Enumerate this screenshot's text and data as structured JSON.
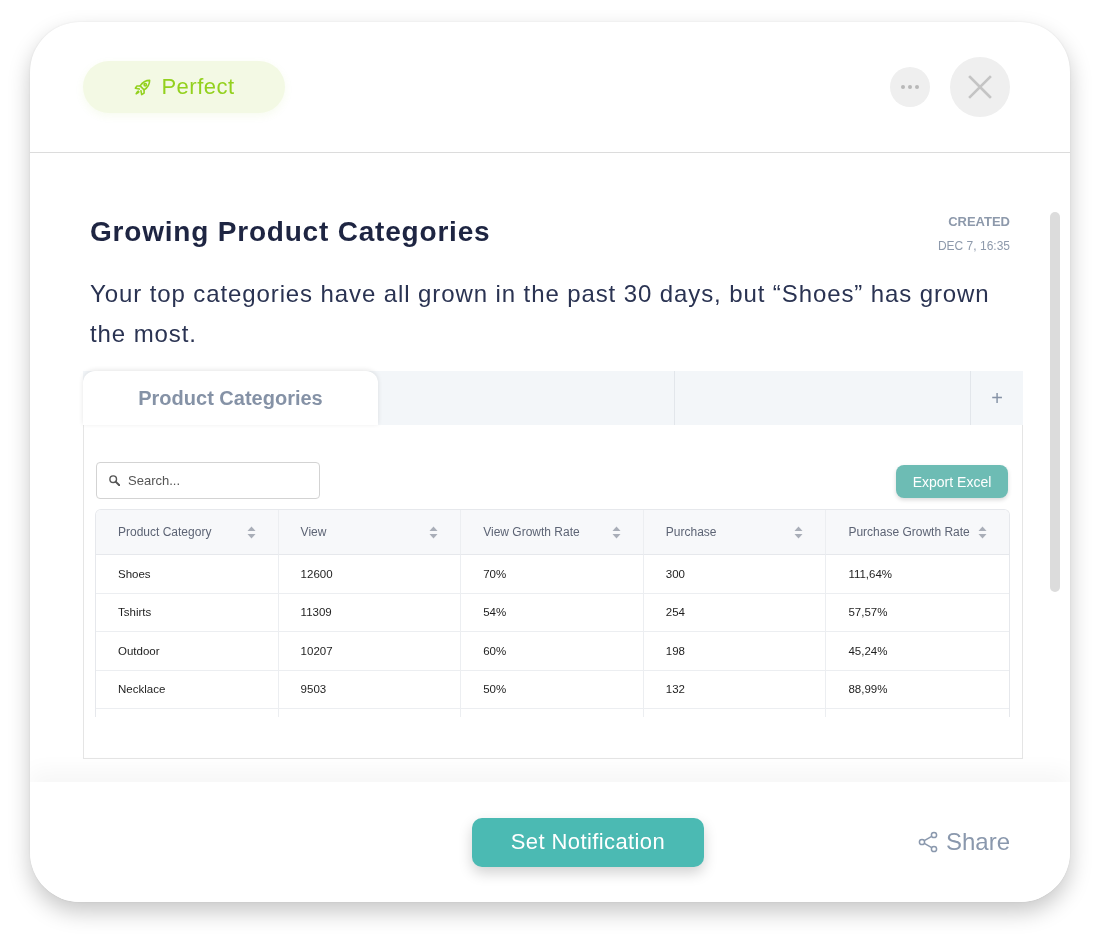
{
  "header": {
    "badge": {
      "label": "Perfect"
    }
  },
  "insight": {
    "title": "Growing Product Categories",
    "created_label": "CREATED",
    "created_date": "DEC 7, 16:35",
    "description": "Your top categories have all grown in the past 30 days, but “Shoes” has grown the most."
  },
  "embedded_view": {
    "tabs": [
      {
        "label": "Product Categories",
        "selected": true
      },
      {
        "selected": false
      },
      {
        "selected": false
      }
    ],
    "add_tab": "+",
    "search": {
      "placeholder": "Search..."
    },
    "export_button": "Export Excel",
    "table": {
      "columns": [
        "Product Category",
        "View",
        "View Growth Rate",
        "Purchase",
        "Purchase Growth Rate"
      ],
      "rows": [
        [
          "Shoes",
          "12600",
          "70%",
          "300",
          "111,64%"
        ],
        [
          "Tshirts",
          "11309",
          "54%",
          "254",
          "57,57%"
        ],
        [
          "Outdoor",
          "10207",
          "60%",
          "198",
          "45,24%"
        ],
        [
          "Necklace",
          "9503",
          "50%",
          "132",
          "88,99%"
        ]
      ]
    }
  },
  "footer": {
    "primary_button": "Set Notification",
    "share": "Share"
  }
}
